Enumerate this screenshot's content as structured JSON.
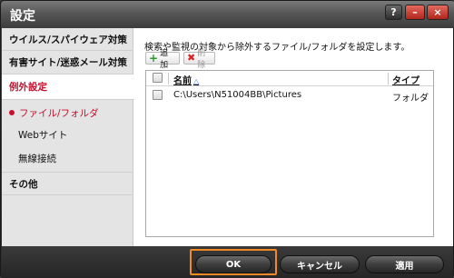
{
  "window": {
    "title": "設定",
    "help_label": "?",
    "minimize_label": "–",
    "close_label": "×"
  },
  "sidebar": {
    "items": [
      {
        "label": "ウイルス/スパイウェア対策"
      },
      {
        "label": "有害サイト/迷惑メール対策"
      },
      {
        "label": "例外設定"
      }
    ],
    "subitems": [
      {
        "label": "ファイル/フォルダ"
      },
      {
        "label": "Webサイト"
      },
      {
        "label": "無線接続"
      }
    ],
    "other": {
      "label": "その他"
    }
  },
  "content": {
    "description": "検索や監視の対象から除外するファイル/フォルダを設定します。",
    "add_label": "追加",
    "delete_label": "削除",
    "columns": {
      "name": "名前",
      "type": "タイプ"
    },
    "rows": [
      {
        "name": "C:\\Users\\N51004BB\\Pictures",
        "type": "フォルダ"
      }
    ]
  },
  "footer": {
    "ok": "OK",
    "cancel": "キャンセル",
    "apply": "適用"
  },
  "colors": {
    "accent": "#c8102e",
    "focus": "#f08a24"
  }
}
